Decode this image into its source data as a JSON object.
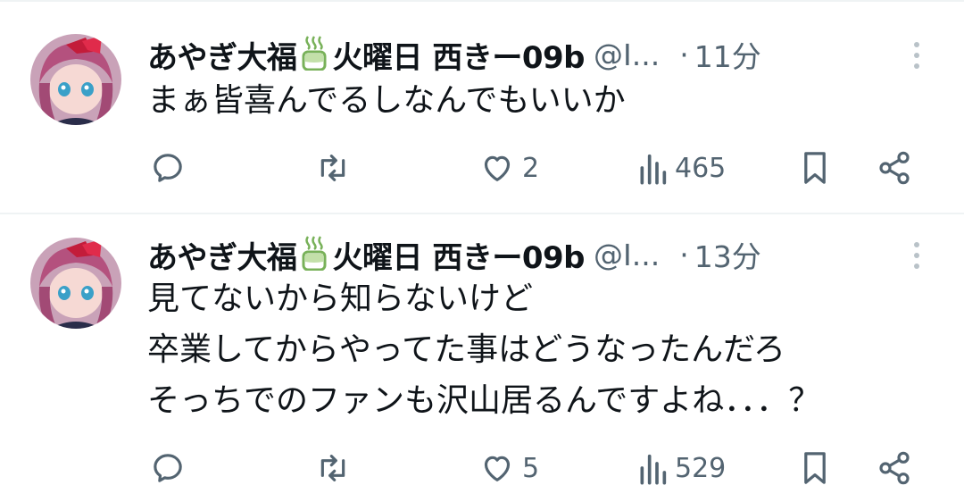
{
  "tweets": [
    {
      "display_name": "あやぎ大福",
      "name_suffix": "火曜日 西きー09b",
      "handle": "@I...",
      "dot": "·",
      "time": "11分",
      "lines": [
        "まぁ皆喜んでるしなんでもいいか"
      ],
      "replies": "",
      "retweets": "",
      "likes": "2",
      "views": "465"
    },
    {
      "display_name": "あやぎ大福",
      "name_suffix": "火曜日 西きー09b",
      "handle": "@I...",
      "dot": "·",
      "time": "13分",
      "lines": [
        "見てないから知らないけど",
        "卒業してからやってた事はどうなったんだろ",
        "そっちでのファンも沢山居るんですよね．．．？"
      ],
      "replies": "",
      "retweets": "",
      "likes": "5",
      "views": "529"
    }
  ],
  "colors": {
    "text": "#0f1419",
    "secondary": "#536471",
    "divider": "#eff3f4",
    "emoji_green": "#78b159"
  },
  "icons": [
    "more-icon",
    "reply-icon",
    "retweet-icon",
    "like-icon",
    "views-icon",
    "bookmark-icon",
    "share-icon",
    "hot-beverage-emoji"
  ]
}
